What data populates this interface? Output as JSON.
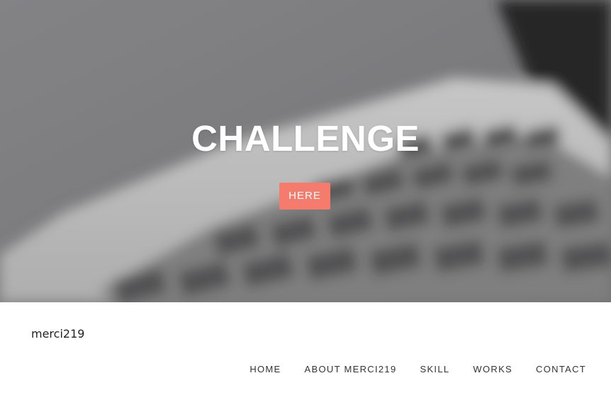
{
  "hero": {
    "title": "CHALLENGE",
    "button_label": "HERE",
    "accent_color": "#f57c6c"
  },
  "header": {
    "logo_text": "merci219"
  },
  "nav": {
    "items": [
      {
        "label": "HOME"
      },
      {
        "label": "ABOUT MERCI219"
      },
      {
        "label": "SKILL"
      },
      {
        "label": "WORKS"
      },
      {
        "label": "CONTACT"
      }
    ]
  }
}
